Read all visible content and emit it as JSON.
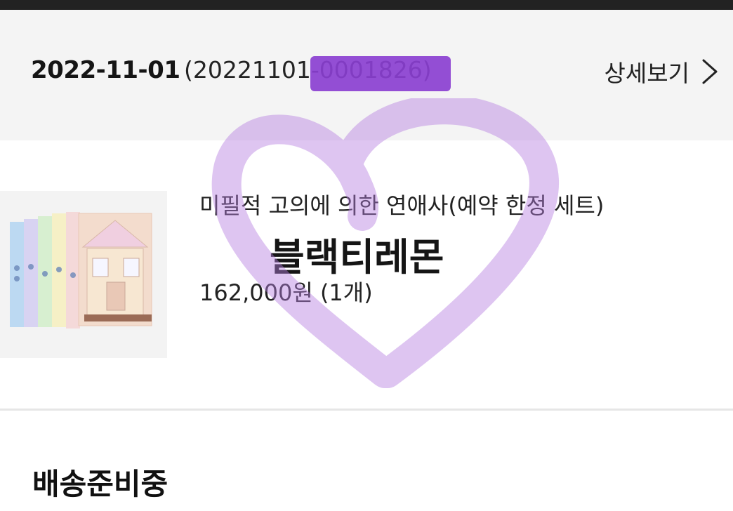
{
  "order": {
    "date": "2022-11-01",
    "number": "(20221101-0001826)",
    "detail_label": "상세보기",
    "detail_icon": "chevron-right-icon"
  },
  "product": {
    "name": "미필적 고의에 의한 연애사(예약 한정 세트)",
    "variant": "블랙티레몬",
    "price_line": "162,000원 (1개)"
  },
  "status": {
    "label": "배송준비중"
  },
  "colors": {
    "header_bg": "#f4f4f4",
    "redaction": "#8a3fd0",
    "heart_stroke": "#b57ee0"
  }
}
